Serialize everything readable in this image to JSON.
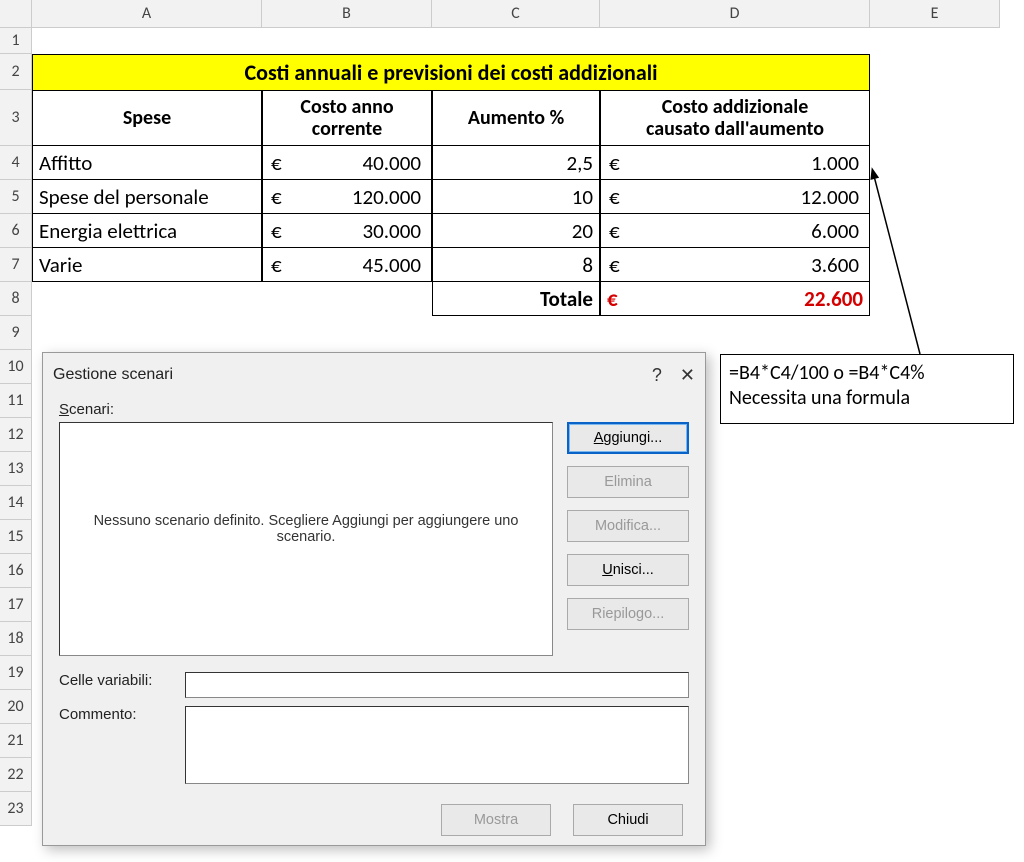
{
  "columns": [
    "",
    "A",
    "B",
    "C",
    "D",
    "E"
  ],
  "rows": [
    "1",
    "2",
    "3",
    "4",
    "5",
    "6",
    "7",
    "8",
    "9",
    "10",
    "11",
    "12",
    "13",
    "14",
    "15",
    "16",
    "17",
    "18",
    "19",
    "20",
    "21",
    "22",
    "23"
  ],
  "title": "Costi annuali e previsioni dei costi addizionali",
  "headers": {
    "spese": "Spese",
    "costo_anno": "Costo anno\ncorrente",
    "aumento": "Aumento %",
    "addizionale": "Costo addizionale\ncausato dall'aumento"
  },
  "currency": "€",
  "data": [
    {
      "label": "Affitto",
      "costo": "40.000",
      "aumento": "2,5",
      "addizionale": "1.000"
    },
    {
      "label": "Spese del personale",
      "costo": "120.000",
      "aumento": "10",
      "addizionale": "12.000"
    },
    {
      "label": "Energia elettrica",
      "costo": "30.000",
      "aumento": "20",
      "addizionale": "6.000"
    },
    {
      "label": "Varie",
      "costo": "45.000",
      "aumento": "8",
      "addizionale": "3.600"
    }
  ],
  "totale": {
    "label": "Totale",
    "value": "22.600"
  },
  "dialog": {
    "title": "Gestione scenari",
    "scenari_label": "Scenari:",
    "empty_msg": "Nessuno scenario definito. Scegliere Aggiungi per aggiungere uno scenario.",
    "buttons": {
      "aggiungi": "Aggiungi...",
      "elimina": "Elimina",
      "modifica": "Modifica...",
      "unisci": "Unisci...",
      "riepilogo": "Riepilogo..."
    },
    "celle_label": "Celle variabili:",
    "commento_label": "Commento:",
    "mostra": "Mostra",
    "chiudi": "Chiudi"
  },
  "annotation": {
    "line1": "=B4*C4/100 o =B4*C4%",
    "line2": "Necessita una formula"
  },
  "chart_data": {
    "type": "table",
    "title": "Costi annuali e previsioni dei costi addizionali",
    "columns": [
      "Spese",
      "Costo anno corrente (€)",
      "Aumento %",
      "Costo addizionale causato dall'aumento (€)"
    ],
    "rows": [
      [
        "Affitto",
        40000,
        2.5,
        1000
      ],
      [
        "Spese del personale",
        120000,
        10,
        12000
      ],
      [
        "Energia elettrica",
        30000,
        20,
        6000
      ],
      [
        "Varie",
        45000,
        8,
        3600
      ]
    ],
    "totale_addizionale": 22600
  }
}
